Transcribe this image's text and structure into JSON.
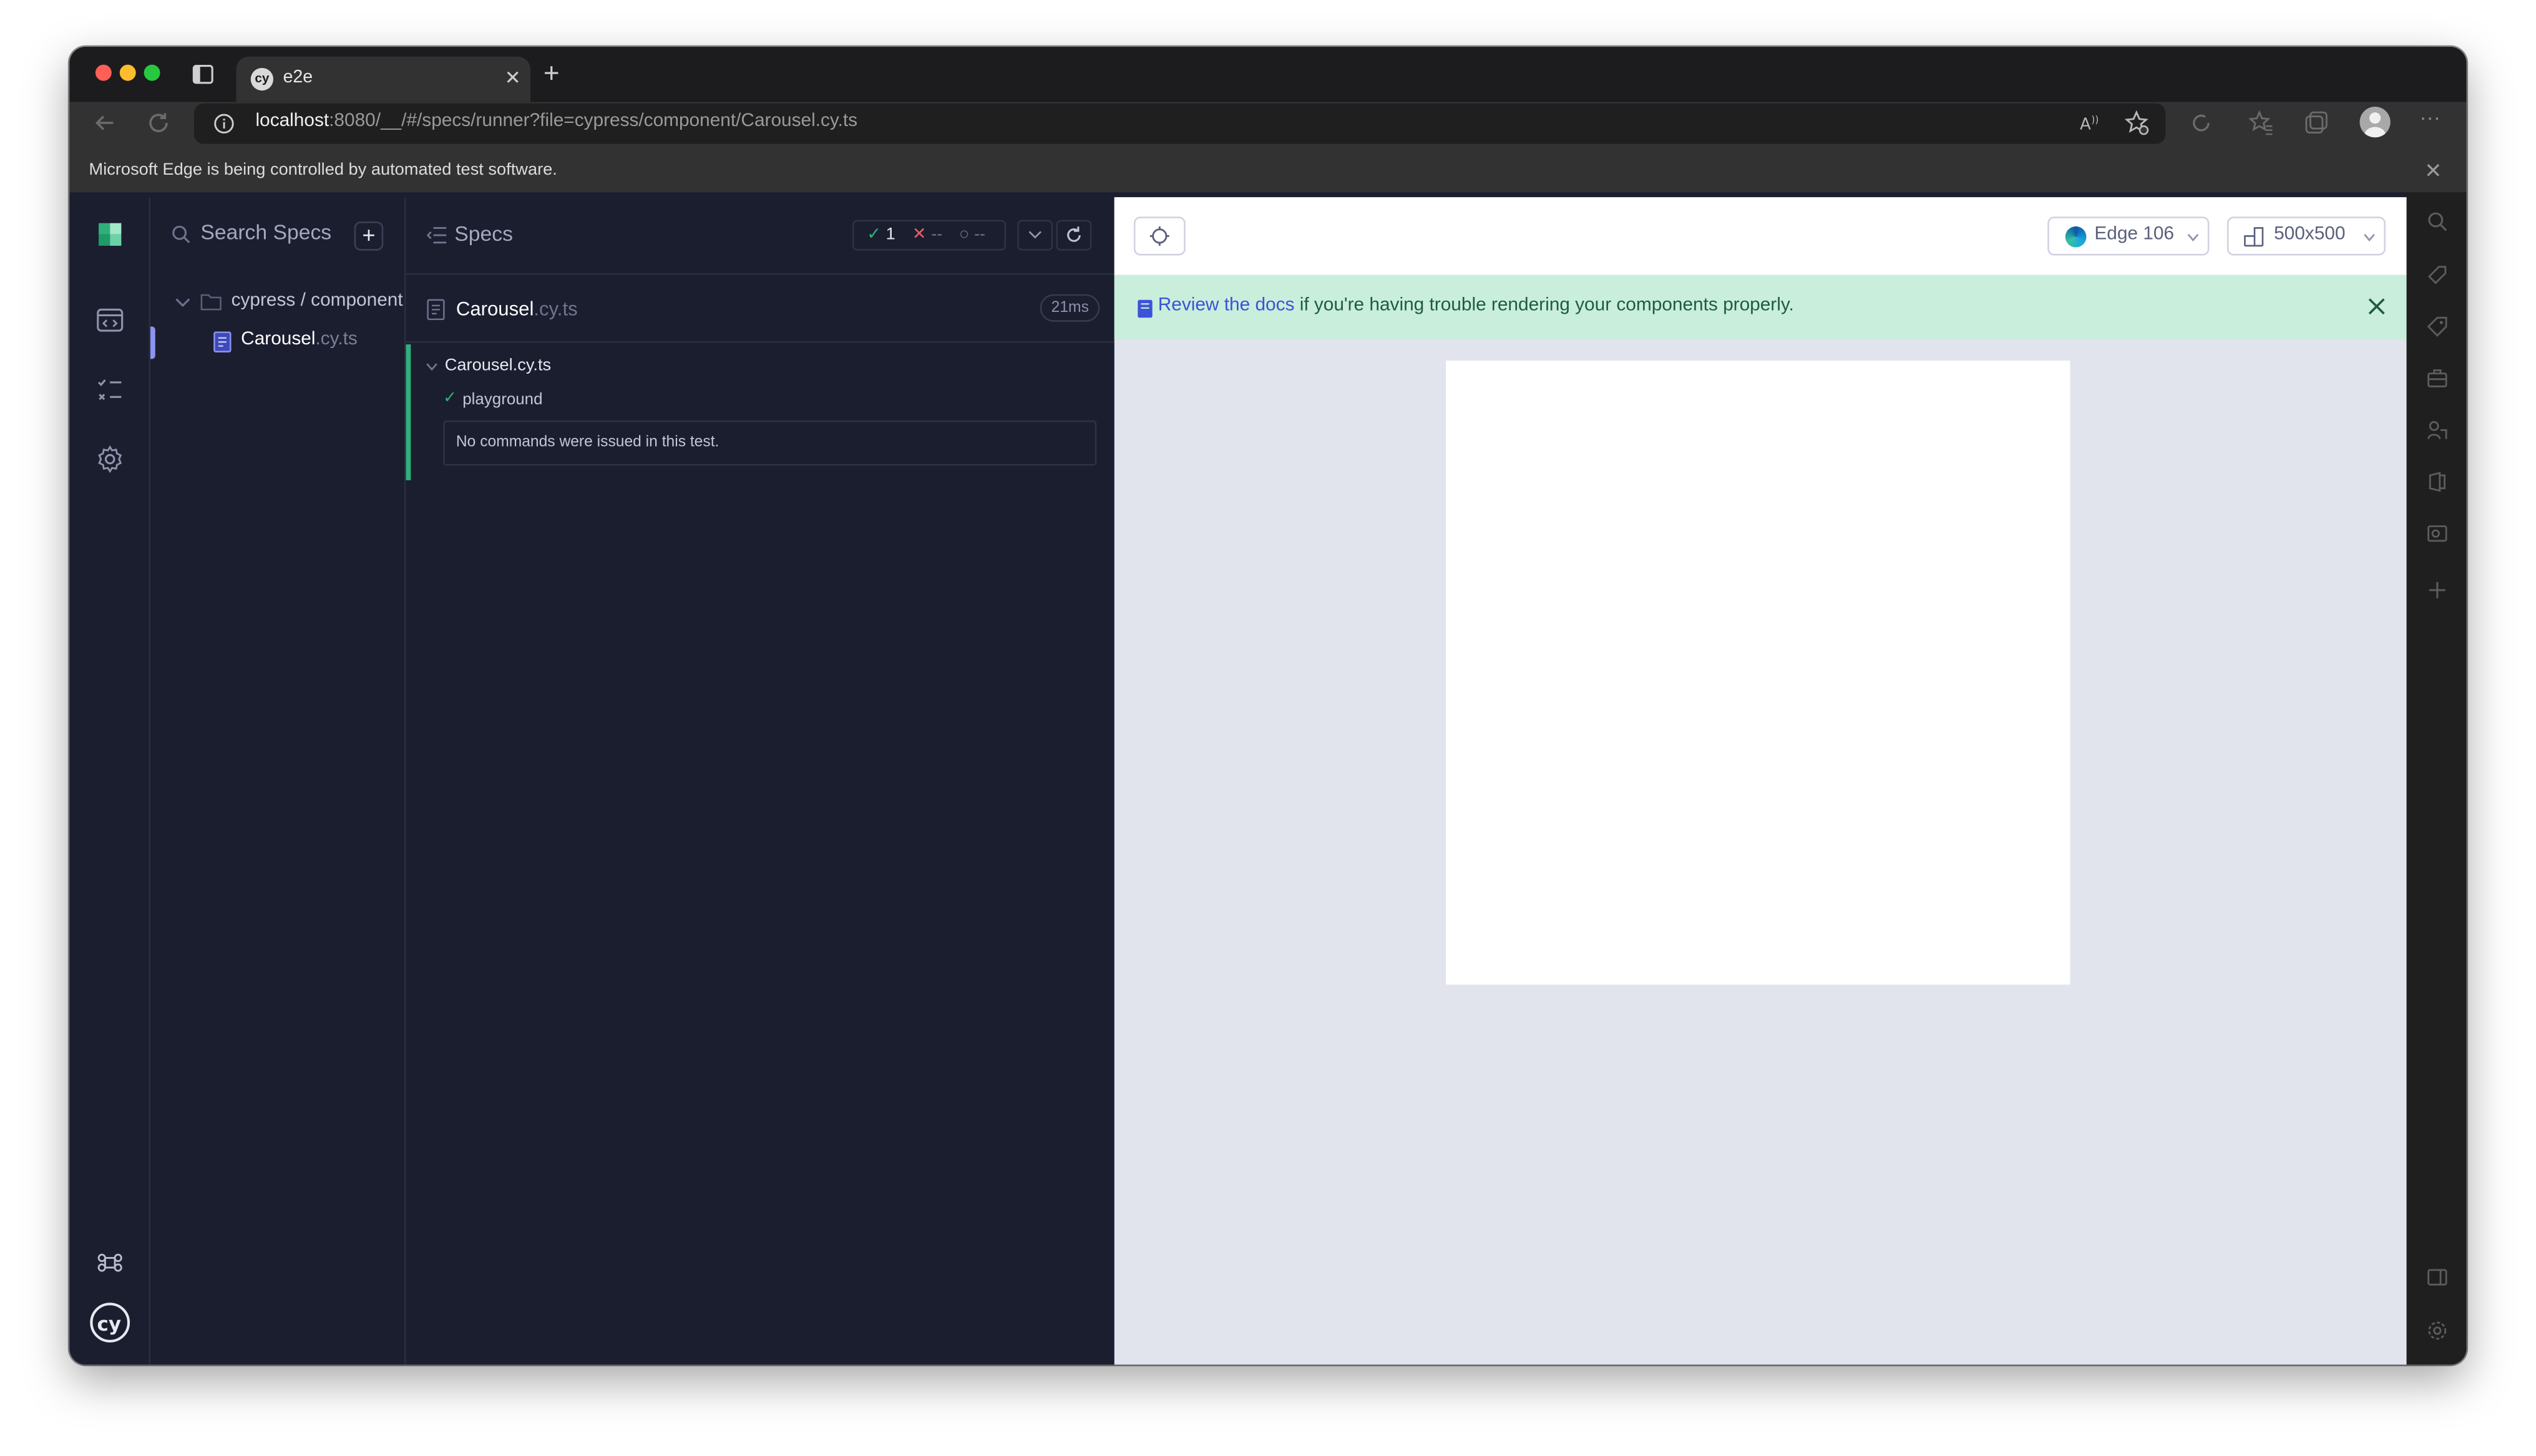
{
  "browser": {
    "tab_title": "e2e",
    "tab_favicon_text": "cy",
    "url_host": "localhost",
    "url_rest": ":8080/__/#/specs/runner?file=cypress/component/Carousel.cy.ts",
    "infobar_text": "Microsoft Edge is being controlled by automated test software."
  },
  "specs_panel": {
    "search_placeholder": "Search Specs",
    "add_label": "+",
    "folder_label": "cypress / component",
    "spec_name": "Carousel",
    "spec_ext": ".cy.ts"
  },
  "reporter": {
    "header_label": "Specs",
    "passed": "1",
    "failed": "--",
    "pending": "--",
    "spec_name": "Carousel",
    "spec_ext": ".cy.ts",
    "duration": "21ms",
    "suite_title": "Carousel.cy.ts",
    "test_title": "playground",
    "no_commands": "No commands were issued in this test."
  },
  "aut": {
    "browser_label": "Edge 106",
    "viewport_label": "500x500",
    "banner_link": "Review the docs",
    "banner_text": " if you're having trouble rendering your components properly."
  },
  "colors": {
    "pass": "#2fb07a",
    "fail": "#e35d6a",
    "accent": "#8c93f0",
    "banner_bg": "#c9eedc",
    "link": "#3c52d8"
  },
  "icons": [
    "tab-actions-icon",
    "back-icon",
    "reload-icon",
    "info-icon",
    "read-aloud-icon",
    "favorite-add-icon",
    "extensions-icon",
    "favorites-icon",
    "collections-icon",
    "profile-avatar",
    "more-icon",
    "cypress-logo-icon",
    "runs-icon",
    "specs-list-icon",
    "settings-icon",
    "keyboard-shortcuts-icon",
    "cypress-cy-icon",
    "search-icon",
    "folder-icon",
    "file-icon",
    "selector-playground-icon",
    "edge-browser-icon",
    "viewport-icon",
    "docs-book-icon",
    "close-icon"
  ]
}
